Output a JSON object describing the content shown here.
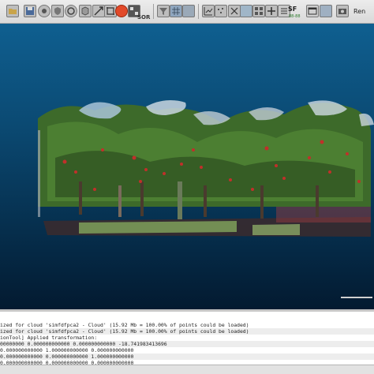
{
  "toolbar": {
    "icons": [
      "open-folder",
      "save-disk",
      "settings-gear",
      "shield",
      "circle-tool",
      "cube-box",
      "pick-point",
      "zoom-scale",
      "translate-tool",
      "crop-tool",
      "point-tool",
      "apple-segment",
      "sor-filter",
      "color-palette",
      "filter-funnel",
      "mesh-grid",
      "graph-chart",
      "sample-points",
      "cross-section",
      "plus-marker",
      "layers",
      "sf-filter",
      "window-panel",
      "camera",
      "render-icon"
    ],
    "sor_label": "SOR",
    "sf_label": "SF",
    "sf_sub": "88-88",
    "render_label": "Ren"
  },
  "console": {
    "lines": [
      "ized for cloud 'simfdfpca2 - Cloud' (15.92 Mb = 100.00% of points could be loaded)",
      "ized for cloud 'simfdfpca2 - Cloud' (15.92 Mb = 100.00% of points could be loaded)",
      "ionTool] Applied transformation:",
      "00000000 0.000000000000 0.000000000000 -18.741983413696",
      "0.000000000000 1.000000000000 0.000000000000",
      "0.000000000000 0.000000000000 1.000000000000",
      "0.000000000000 0.000000000000 0.000000000000"
    ]
  }
}
